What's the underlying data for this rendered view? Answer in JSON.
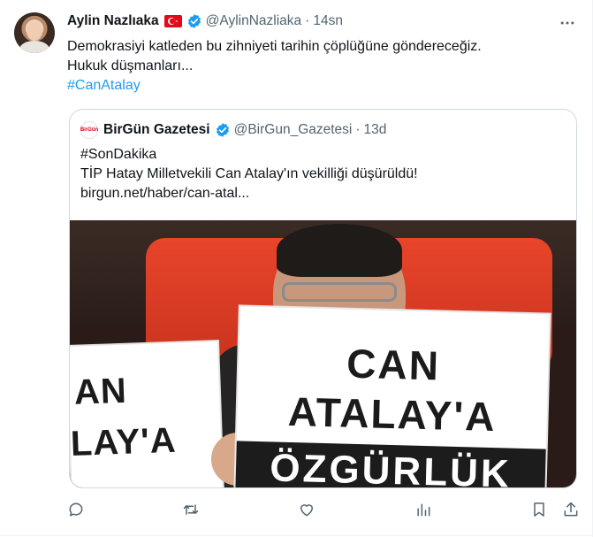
{
  "tweet": {
    "author_name": "Aylin Nazlıaka",
    "handle": "@AylinNazliaka",
    "separator": "·",
    "time": "14sn",
    "text_lines": [
      "Demokrasiyi katleden bu zihniyeti tarihin çöplüğüne göndereceğiz.",
      "Hukuk düşmanları..."
    ],
    "hashtag": "#CanAtalay",
    "icons": {
      "flag": "turkey-flag-icon",
      "verified": "verified-badge-icon",
      "more": "more-options-icon"
    }
  },
  "quote": {
    "author_name": "BirGün Gazetesi",
    "avatar_text": "BirGün",
    "handle": "@BirGun_Gazetesi",
    "separator": "·",
    "time": "13d",
    "text_lines": [
      "#SonDakika",
      "TİP Hatay Milletvekili Can Atalay'ın vekilliği düşürüldü!",
      "birgun.net/haber/can-atal..."
    ],
    "image": {
      "left_sign_lines": [
        "AN",
        "LAY'A"
      ],
      "right_sign_lines": [
        "CAN",
        "ATALAY'A",
        "ÖZGÜRLÜK"
      ]
    }
  },
  "actions": [
    {
      "name": "reply-icon"
    },
    {
      "name": "retweet-icon"
    },
    {
      "name": "like-icon"
    },
    {
      "name": "views-icon"
    },
    {
      "name": "bookmark-icon"
    },
    {
      "name": "share-icon"
    }
  ],
  "colors": {
    "accent": "#1d9bf0",
    "text": "#0f1419",
    "secondary": "#536471",
    "border": "#cfd9de",
    "flag_red": "#e30a17"
  }
}
